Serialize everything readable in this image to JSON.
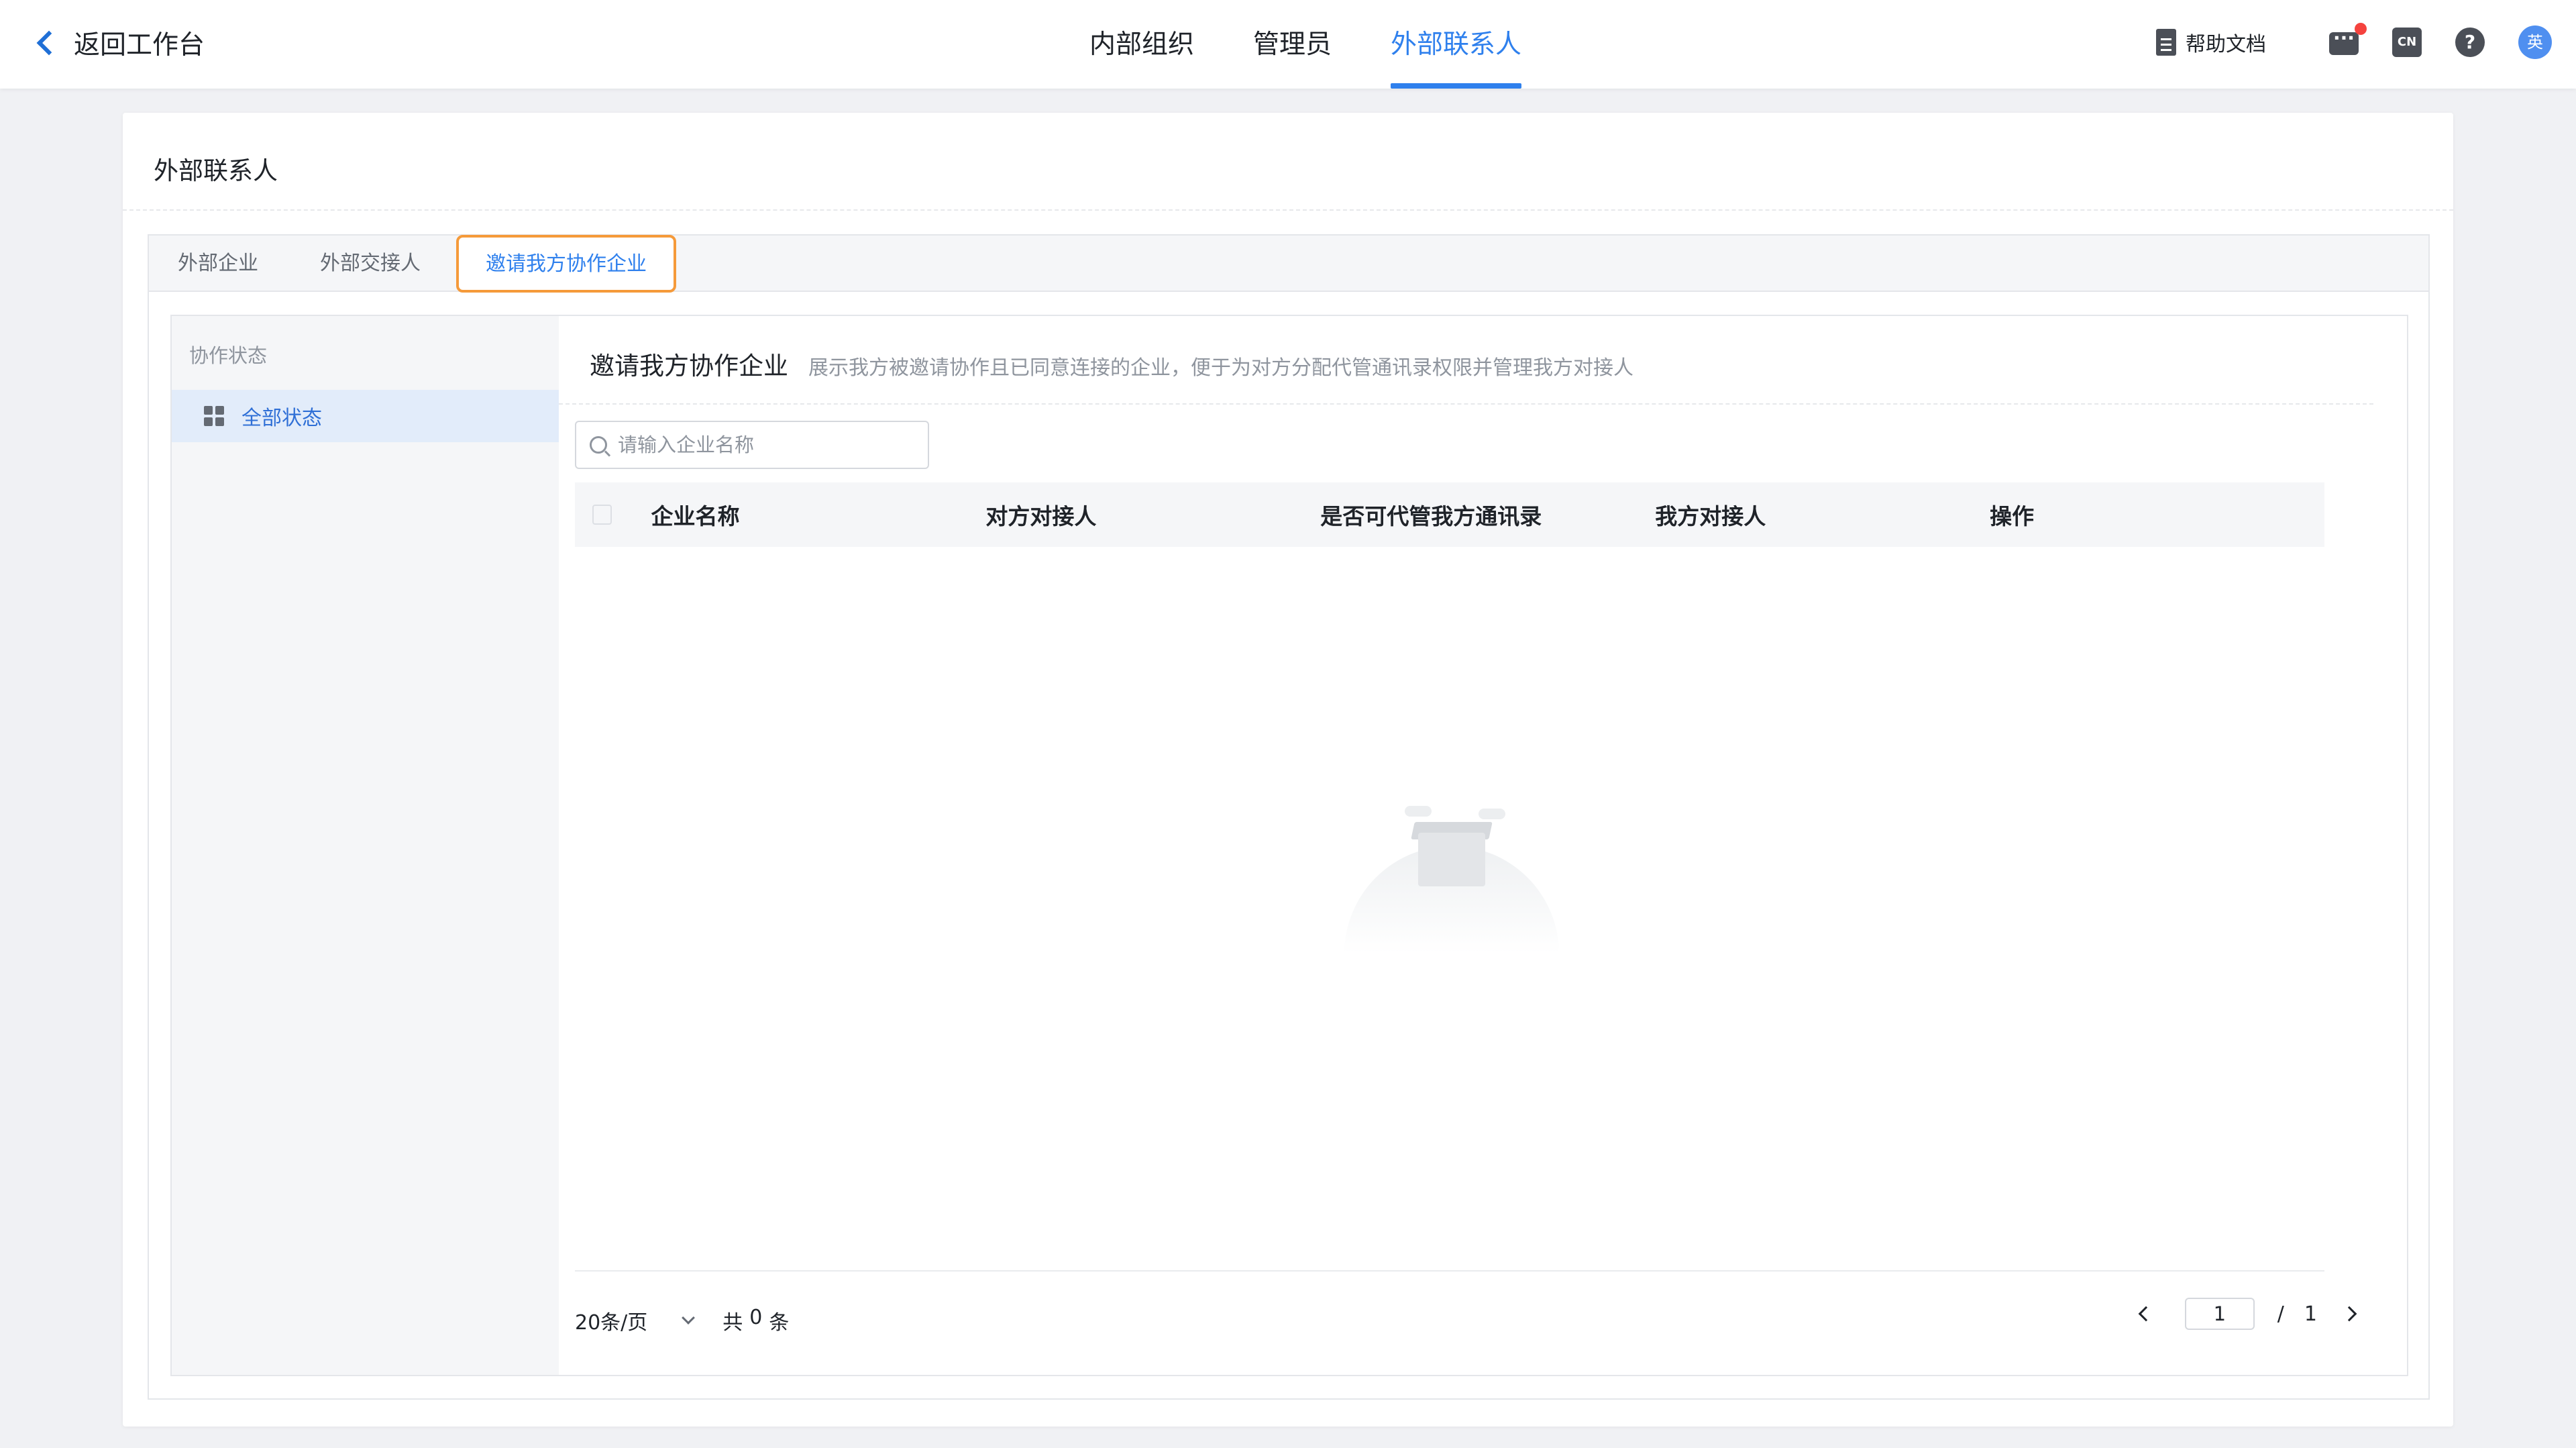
{
  "header": {
    "back_label": "返回工作台",
    "nav_tabs": [
      "内部组织",
      "管理员",
      "外部联系人"
    ],
    "help_doc_label": "帮助文档",
    "lang_badge": "CN",
    "help_symbol": "?",
    "avatar_text": "英",
    "accent": "#2f80ed"
  },
  "card": {
    "title": "外部联系人",
    "subtabs": [
      "外部企业",
      "外部交接人",
      "邀请我方协作企业"
    ]
  },
  "sidebar": {
    "section_title": "协作状态",
    "items": [
      {
        "label": "全部状态",
        "icon": "grid-icon"
      }
    ]
  },
  "content": {
    "title": "邀请我方协作企业",
    "description": "展示我方被邀请协作且已同意连接的企业，便于为对方分配代管通讯录权限并管理我方对接人",
    "search_placeholder": "请输入企业名称",
    "columns": [
      "企业名称",
      "对方对接人",
      "是否可代管我方通讯录",
      "我方对接人",
      "操作"
    ],
    "rows": []
  },
  "pagination": {
    "page_size": "20条/页",
    "total_prefix": "共",
    "total_count": "0",
    "total_suffix": "条",
    "current_page": "1",
    "separator": "/",
    "total_pages": "1"
  }
}
